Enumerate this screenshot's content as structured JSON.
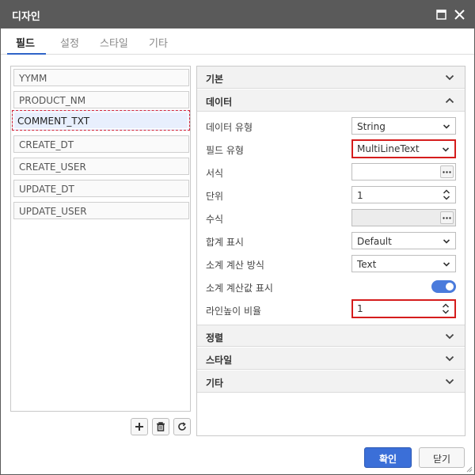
{
  "dialog": {
    "title": "디자인"
  },
  "tabs": [
    {
      "label": "필드",
      "active": true
    },
    {
      "label": "설정",
      "active": false
    },
    {
      "label": "스타일",
      "active": false
    },
    {
      "label": "기타",
      "active": false
    }
  ],
  "fields": [
    {
      "name": "YYMM",
      "selected": false
    },
    {
      "name": "PRODUCT_NM",
      "selected": false
    },
    {
      "name": "COMMENT_TXT",
      "selected": true
    },
    {
      "name": "CREATE_DT",
      "selected": false
    },
    {
      "name": "CREATE_USER",
      "selected": false
    },
    {
      "name": "UPDATE_DT",
      "selected": false
    },
    {
      "name": "UPDATE_USER",
      "selected": false
    }
  ],
  "list_buttons": {
    "add_icon": "plus-icon",
    "delete_icon": "trash-icon",
    "refresh_icon": "refresh-icon"
  },
  "sections": {
    "basic": {
      "title": "기본",
      "expanded": false
    },
    "data": {
      "title": "데이터",
      "expanded": true
    },
    "sort": {
      "title": "정렬",
      "expanded": false
    },
    "style": {
      "title": "스타일",
      "expanded": false
    },
    "etc": {
      "title": "기타",
      "expanded": false
    }
  },
  "properties": {
    "data_type": {
      "label": "데이터 유형",
      "value": "String"
    },
    "field_type": {
      "label": "필드 유형",
      "value": "MultiLineText"
    },
    "format": {
      "label": "서식",
      "value": ""
    },
    "unit": {
      "label": "단위",
      "value": "1"
    },
    "formula": {
      "label": "수식",
      "value": ""
    },
    "total_display": {
      "label": "합계 표시",
      "value": "Default"
    },
    "subtotal_method": {
      "label": "소계 계산 방식",
      "value": "Text"
    },
    "subtotal_display": {
      "label": "소계 계산값 표시",
      "value": true
    },
    "line_height_ratio": {
      "label": "라인높이 비율",
      "value": "1"
    }
  },
  "footer": {
    "ok_label": "확인",
    "close_label": "닫기"
  },
  "colors": {
    "titlebar": "#5a5a5a",
    "accent": "#3b6fd8",
    "highlight": "#d51d1d",
    "selection_border": "#d6283a"
  }
}
